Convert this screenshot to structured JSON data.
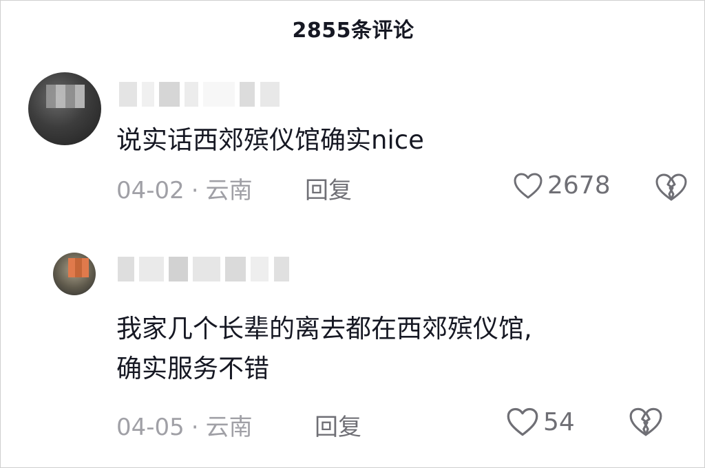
{
  "header": {
    "title": "2855条评论"
  },
  "comments": [
    {
      "username": "",
      "text": "说实话西郊殡仪馆确实nice",
      "date": "04-02",
      "separator": "·",
      "location": "云南",
      "reply_label": "回复",
      "likes": "2678"
    },
    {
      "username": "",
      "text_line1": "我家几个长辈的离去都在西郊殡仪馆,",
      "text_line2": "确实服务不错",
      "date": "04-05",
      "separator": "·",
      "location": "云南",
      "reply_label": "回复",
      "likes": "54"
    }
  ],
  "icons": {
    "like": "heart-outline-icon",
    "dislike": "broken-heart-icon"
  },
  "colors": {
    "text_primary": "#161823",
    "text_meta": "#a0a0a6",
    "icon": "#6f6f75"
  }
}
